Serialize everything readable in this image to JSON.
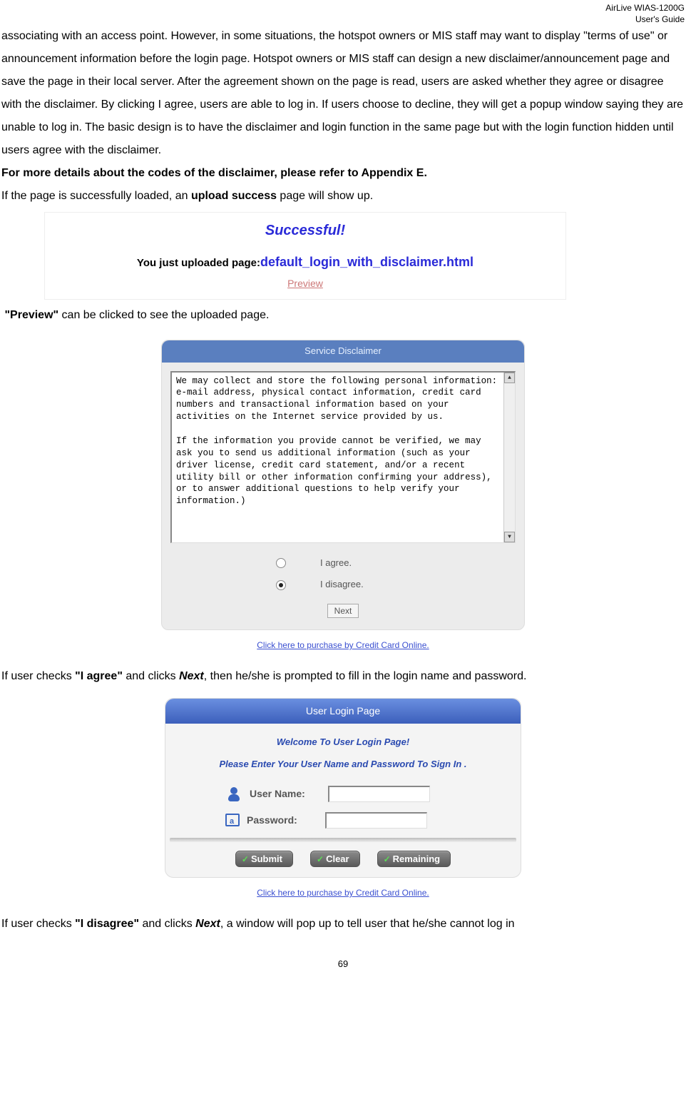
{
  "header": {
    "line1": "AirLive WIAS-1200G",
    "line2": "User's Guide"
  },
  "p1": "associating with an access point. However, in some situations, the hotspot owners or MIS staff may want to display \"terms of use\" or announcement information before the login page. Hotspot owners or MIS staff can design a new disclaimer/announcement page and save the page in their local server. After the agreement shown on the page is read, users are asked whether they agree or disagree with the disclaimer. By clicking I agree, users are able to log in. If users choose to decline, they will get a popup window saying they are unable to log in. The basic design is to have the disclaimer and login function in the same page but with the login function hidden until users agree with the disclaimer.",
  "p2": "For more details about the codes of the disclaimer, please refer to Appendix E.",
  "p3a": "If the page is successfully loaded, an ",
  "p3b": "upload success",
  "p3c": " page will show up.",
  "successbox": {
    "title": "Successful!",
    "text_prefix": "You just uploaded page:",
    "filename": "default_login_with_disclaimer.html",
    "preview": "Preview"
  },
  "p4a": "\"Preview\"",
  "p4b": " can be clicked to see the uploaded page.",
  "disclaimer": {
    "header": "Service Disclaimer",
    "text": "We may collect and store the following personal information:\ne-mail address, physical contact information, credit card numbers and transactional information based on your activities on the Internet service provided by us.\n\nIf the information you provide cannot be verified, we may ask you to send us additional information (such as your driver license, credit card statement, and/or a recent utility bill or other information confirming your address), or to answer additional questions to help verify your information.)",
    "agree": "I agree.",
    "disagree": "I disagree.",
    "next": "Next",
    "cc_link": "Click here to purchase by Credit Card Online."
  },
  "p5a": "If user checks ",
  "p5b": "\"I agree\"",
  "p5c": " and clicks ",
  "p5d": "Next",
  "p5e": ", then he/she is prompted to fill in the login name and password.",
  "login": {
    "header": "User Login Page",
    "welcome": "Welcome To User Login Page!",
    "instr": "Please Enter Your User Name and Password To Sign In .",
    "user_label": "User Name:",
    "pw_label": "Password:",
    "submit": "Submit",
    "clear": "Clear",
    "remaining": "Remaining",
    "cc_link": "Click here to purchase by Credit Card Online."
  },
  "p6a": "If user checks ",
  "p6b": "\"I disagree\"",
  "p6c": " and clicks ",
  "p6d": "Next",
  "p6e": ", a window will pop up to tell user that he/she cannot log in",
  "page_number": "69"
}
